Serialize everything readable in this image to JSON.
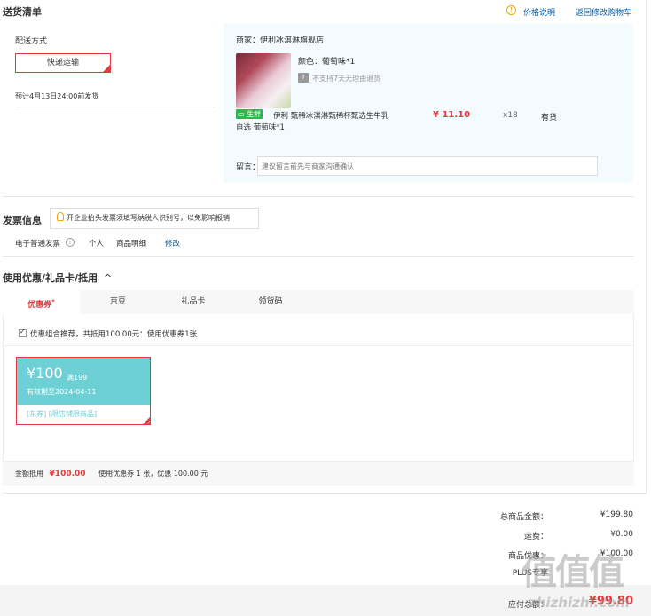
{
  "shipping": {
    "section_title": "送货清单",
    "price_info_icon": "info-circle-icon",
    "price_info_link": "价格说明",
    "back_to_cart_link": "返回修改购物车",
    "method_label": "配送方式",
    "method_button": "快递运输",
    "estimate": "预计4月13日24:00前发货",
    "shop_label": "商家：伊利冰淇淋旗舰店",
    "product": {
      "color": "颜色：葡萄味*1",
      "no_return": "不支持7天无理由退货",
      "fresh_badge": "生鲜",
      "name_line1": "伊利 甄稀冰淇淋甄稀杯甄选生牛乳",
      "name_line2": "自选 葡萄味*1",
      "price": "¥ 11.10",
      "qty": "x18",
      "stock": "有货"
    },
    "note_label": "留言：",
    "note_placeholder": "建议留言前先与商家沟通确认"
  },
  "invoice": {
    "title": "发票信息",
    "tip": "开企业抬头发票须填写纳税人识别号，以免影响报销",
    "type": "电子普通发票",
    "holder": "个人",
    "content": "商品明细",
    "edit": "修改"
  },
  "discount": {
    "title": "使用优惠/礼品卡/抵用",
    "chevron": "^",
    "tabs": [
      {
        "label": "优惠券",
        "mark": "*"
      },
      {
        "label": "京豆"
      },
      {
        "label": "礼品卡"
      },
      {
        "label": "领货码"
      }
    ],
    "combo_text": "优惠组合推荐，共抵用100.00元：使用优惠券1张",
    "coupon": {
      "amount": "¥100",
      "condition": "满199",
      "validity": "有效期至2024-04-11",
      "scope": "[东券] [限店铺限商品]"
    },
    "summary_label": "金额抵用",
    "summary_amount": "¥100.00",
    "summary_detail": "使用优惠券 1 张，优惠 100.00 元"
  },
  "totals": {
    "goods_label": "总商品金额：",
    "goods_value": "¥199.80",
    "shipping_label": "运费：",
    "shipping_value": "¥0.00",
    "discount_label": "商品优惠：",
    "discount_value": "¥100.00",
    "plus_label": "PLUS专享",
    "pay_label": "应付总额：",
    "pay_value": "¥99.80"
  },
  "watermark": {
    "big": "值值值",
    "url": "zhizhizhi.com"
  },
  "colors": {
    "accent_red": "#e4393c",
    "link_blue": "#005aa0",
    "coupon_teal": "#6dd0d4",
    "fresh_green": "#2db84d"
  }
}
